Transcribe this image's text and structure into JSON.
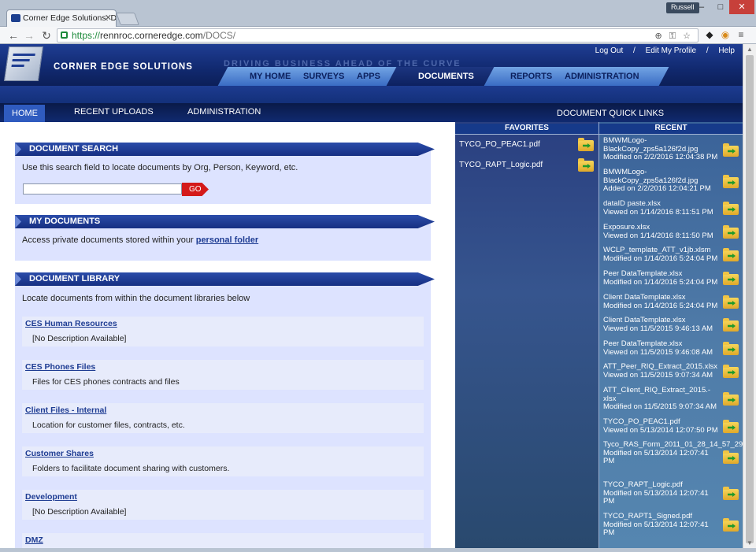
{
  "browser": {
    "tab_title": "Corner Edge Solutions: Do",
    "profile": "Russell",
    "url_scheme": "https://",
    "url_host": "rennroc.corneredge.com",
    "url_path": "/DOCS/"
  },
  "header": {
    "logo_text": "CORNER EDGE SOLUTIONS",
    "tagline": "DRIVING BUSINESS AHEAD OF THE CURVE",
    "top_links": [
      "Log Out",
      "Edit My Profile",
      "Help"
    ],
    "main_nav": [
      "MY HOME",
      "SURVEYS",
      "APPS",
      "DOCUMENTS",
      "REPORTS",
      "ADMINISTRATION"
    ]
  },
  "subnav": {
    "tabs": [
      "HOME",
      "RECENT UPLOADS",
      "ADMINISTRATION"
    ],
    "quick_links_title": "DOCUMENT QUICK LINKS"
  },
  "search": {
    "title": "DOCUMENT SEARCH",
    "description": "Use this search field to locate documents by Org, Person, Keyword, etc.",
    "input_value": "",
    "go_label": "GO"
  },
  "my_documents": {
    "title": "MY DOCUMENTS",
    "text_before": "Access private documents stored within your",
    "link": "personal folder"
  },
  "library": {
    "title": "DOCUMENT LIBRARY",
    "description": "Locate documents from within the document libraries below",
    "items": [
      {
        "name": "CES Human Resources",
        "desc": "[No Description Available]"
      },
      {
        "name": "CES Phones Files",
        "desc": "Files for CES phones contracts and files"
      },
      {
        "name": "Client Files - Internal",
        "desc": "Location for customer files, contracts, etc."
      },
      {
        "name": "Customer Shares",
        "desc": "Folders to facilitate document sharing with customers."
      },
      {
        "name": "Development",
        "desc": "[No Description Available]"
      },
      {
        "name": "DMZ",
        "desc": ""
      }
    ]
  },
  "favorites": {
    "title": "FAVORITES",
    "items": [
      "TYCO_PO_PEAC1.pdf",
      "TYCO_RAPT_Logic.pdf"
    ]
  },
  "recent": {
    "title": "RECENT",
    "items": [
      {
        "name": "BMWMLogo-BlackCopy_zps5a126f2d.jpg",
        "meta": "Modified on 2/2/2016 12:04:38 PM"
      },
      {
        "name": "BMWMLogo-BlackCopy_zps5a126f2d.jpg",
        "meta": "Added on 2/2/2016 12:04:21 PM"
      },
      {
        "name": "dataID paste.xlsx",
        "meta": "Viewed on 1/14/2016 8:11:51 PM"
      },
      {
        "name": "Exposure.xlsx",
        "meta": "Viewed on 1/14/2016 8:11:50 PM"
      },
      {
        "name": "WCLP_template_ATT_v1jb.xlsm",
        "meta": "Modified on 1/14/2016 5:24:04 PM"
      },
      {
        "name": "Peer DataTemplate.xlsx",
        "meta": "Modified on 1/14/2016 5:24:04 PM"
      },
      {
        "name": "Client DataTemplate.xlsx",
        "meta": "Modified on 1/14/2016 5:24:04 PM"
      },
      {
        "name": "Client DataTemplate.xlsx",
        "meta": "Viewed on 11/5/2015 9:46:13 AM"
      },
      {
        "name": "Peer DataTemplate.xlsx",
        "meta": "Viewed on 11/5/2015 9:46:08 AM"
      },
      {
        "name": "ATT_Peer_RIQ_Extract_2015.xlsx",
        "meta": "Viewed on 11/5/2015 9:07:34 AM"
      },
      {
        "name": "ATT_Client_RIQ_Extract_2015.-xlsx",
        "meta": "Modified on 11/5/2015 9:07:34 AM"
      },
      {
        "name": "TYCO_PO_PEAC1.pdf",
        "meta": "Viewed on 5/13/2014 12:07:50 PM"
      },
      {
        "name": "Tyco_RAS_Form_2011_01_28_14_57_29.pdf",
        "meta": "Modified on 5/13/2014 12:07:41 PM"
      },
      {
        "name": "TYCO_RAPT_Logic.pdf",
        "meta": "Modified on 5/13/2014 12:07:41 PM"
      },
      {
        "name": "TYCO_RAPT1_Signed.pdf",
        "meta": "Modified on 5/13/2014 12:07:41 PM"
      }
    ]
  }
}
